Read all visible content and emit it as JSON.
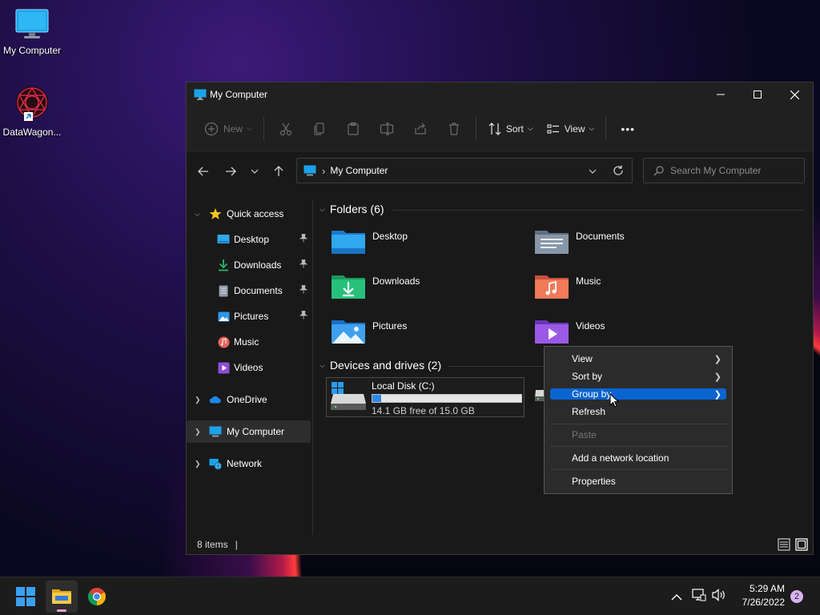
{
  "desktop": {
    "icons": [
      {
        "label": "My Computer"
      },
      {
        "label": "DataWagon..."
      }
    ]
  },
  "window": {
    "title": "My Computer",
    "toolbar": {
      "new_label": "New",
      "sort_label": "Sort",
      "view_label": "View",
      "more_label": "•••"
    },
    "address": {
      "location": "My Computer",
      "separator": "›"
    },
    "search": {
      "placeholder": "Search My Computer"
    },
    "sidebar": {
      "quick_access": "Quick access",
      "items": [
        {
          "label": "Desktop",
          "pinned": true
        },
        {
          "label": "Downloads",
          "pinned": true
        },
        {
          "label": "Documents",
          "pinned": true
        },
        {
          "label": "Pictures",
          "pinned": true
        },
        {
          "label": "Music",
          "pinned": false
        },
        {
          "label": "Videos",
          "pinned": false
        }
      ],
      "onedrive": "OneDrive",
      "my_computer": "My Computer",
      "network": "Network"
    },
    "content": {
      "folders_header": "Folders (6)",
      "folders": [
        {
          "name": "Desktop"
        },
        {
          "name": "Documents"
        },
        {
          "name": "Downloads"
        },
        {
          "name": "Music"
        },
        {
          "name": "Pictures"
        },
        {
          "name": "Videos"
        }
      ],
      "drives_header": "Devices and drives (2)",
      "drive": {
        "name": "Local Disk (C:)",
        "free_text": "14.1 GB free of 15.0 GB",
        "used_fraction": 0.06
      }
    },
    "status": {
      "items": "8 items"
    }
  },
  "context_menu": {
    "items": [
      "View",
      "Sort by",
      "Group by",
      "Refresh",
      "Paste",
      "Add a network location",
      "Properties"
    ]
  },
  "tray": {
    "time": "5:29 AM",
    "date": "7/26/2022",
    "notifications": "2"
  },
  "colors": {
    "accent": "#0a64d0",
    "drive_fill": "#2e8ae6"
  }
}
